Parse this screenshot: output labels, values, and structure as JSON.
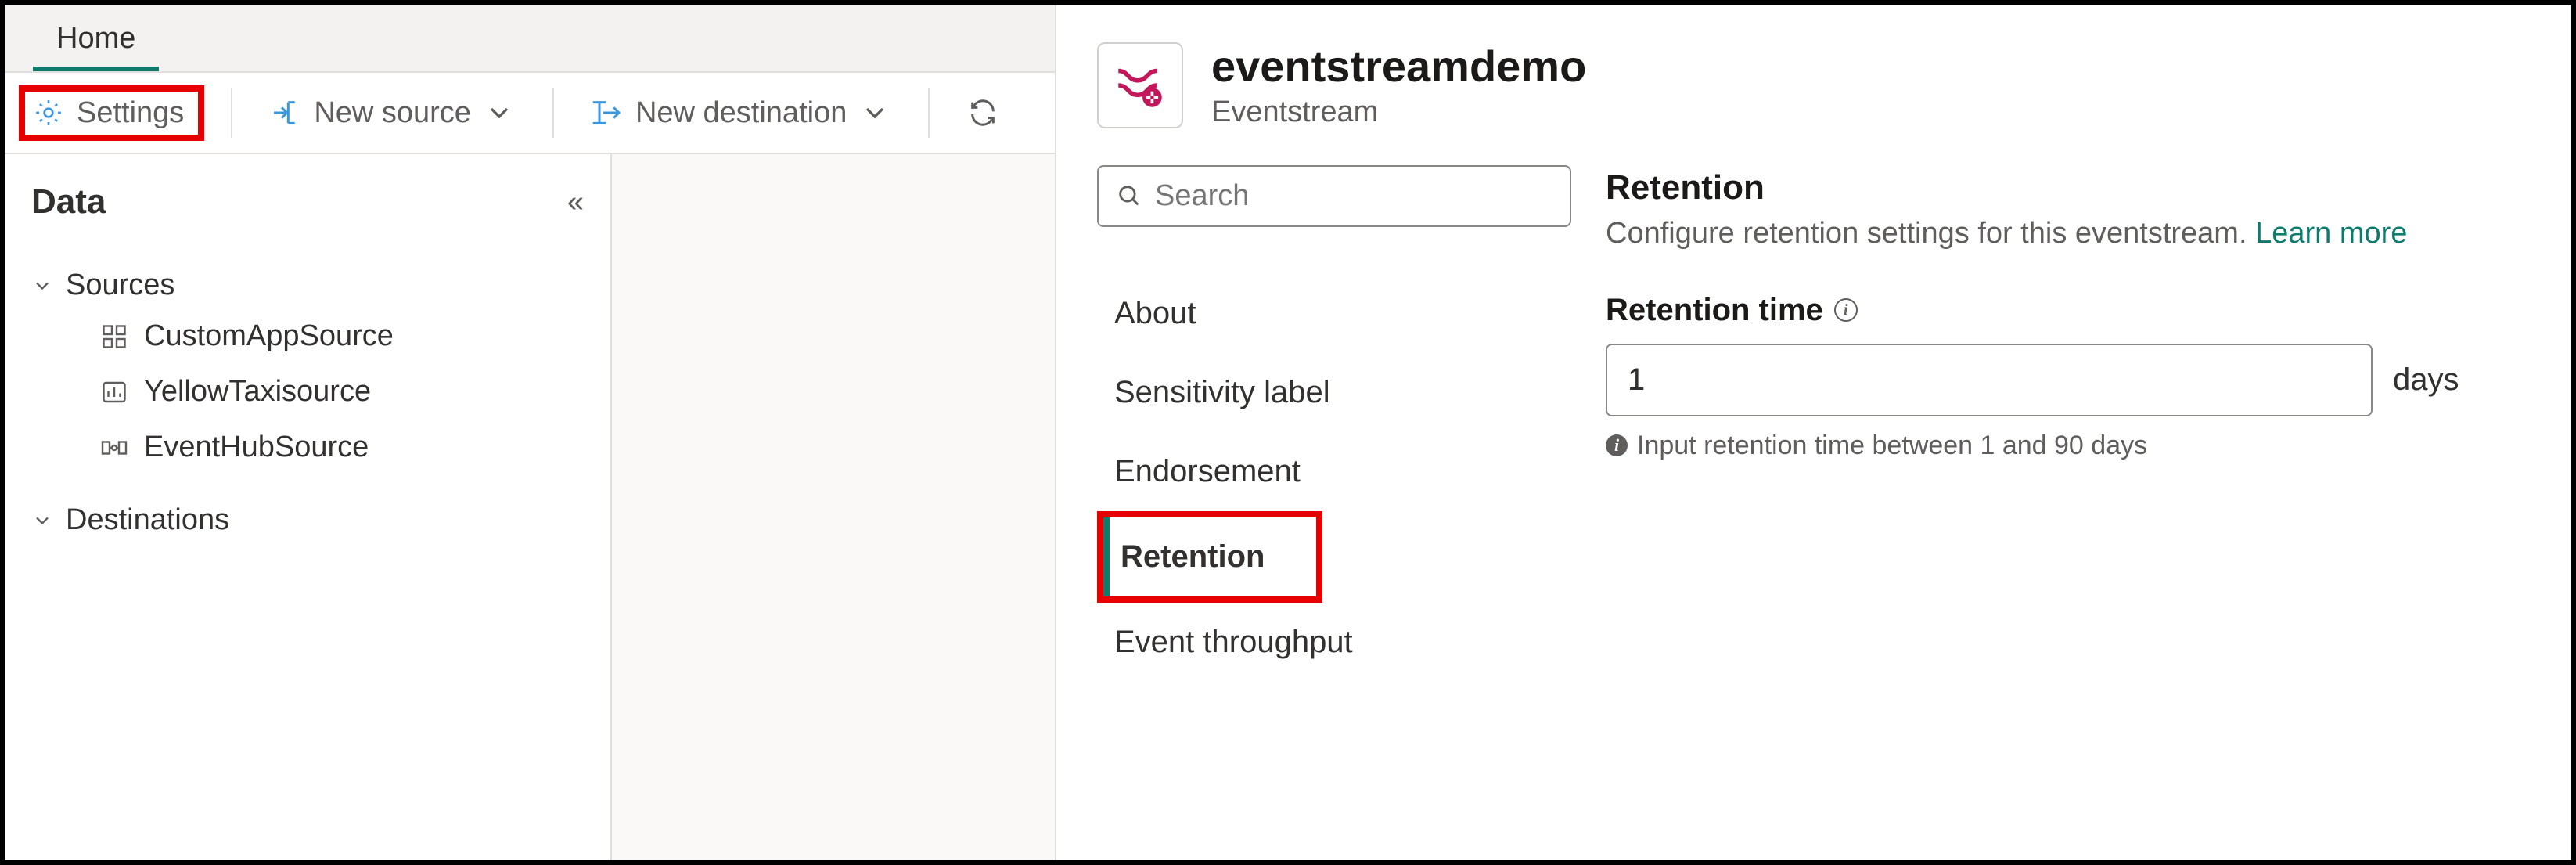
{
  "tabs": {
    "home": "Home"
  },
  "toolbar": {
    "settings": "Settings",
    "new_source": "New source",
    "new_destination": "New destination"
  },
  "data_panel": {
    "title": "Data",
    "sources_label": "Sources",
    "destinations_label": "Destinations",
    "sources": [
      {
        "name": "CustomAppSource"
      },
      {
        "name": "YellowTaxisource"
      },
      {
        "name": "EventHubSource"
      }
    ]
  },
  "settings_panel": {
    "title": "eventstreamdemo",
    "subtitle": "Eventstream",
    "search_placeholder": "Search",
    "nav": {
      "about": "About",
      "sensitivity": "Sensitivity label",
      "endorsement": "Endorsement",
      "retention": "Retention",
      "throughput": "Event throughput"
    },
    "retention": {
      "heading": "Retention",
      "description": "Configure retention settings for this eventstream. ",
      "learn_more": "Learn more",
      "field_label": "Retention time",
      "value": "1",
      "unit": "days",
      "hint": "Input retention time between 1 and 90 days"
    }
  }
}
